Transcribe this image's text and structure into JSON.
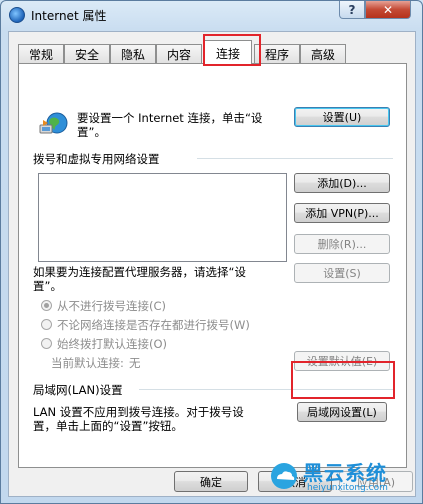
{
  "window": {
    "title": "Internet 属性",
    "help_label": "?",
    "close_label": "✕",
    "icon": "globe-icon"
  },
  "tabs": [
    {
      "label": "常规"
    },
    {
      "label": "安全"
    },
    {
      "label": "隐私"
    },
    {
      "label": "内容"
    },
    {
      "label": "连接",
      "active": true
    },
    {
      "label": "程序"
    },
    {
      "label": "高级"
    }
  ],
  "setup": {
    "text_line1": "要设置一个 Internet 连接，单击“设",
    "text_line2": "置”。",
    "button": "设置(U)",
    "icon": "network-globe-icon"
  },
  "dialup": {
    "heading": "拨号和虚拟专用网络设置",
    "add_button": "添加(D)...",
    "add_vpn_button": "添加 VPN(P)...",
    "delete_button": "删除(R)...",
    "proxy_text_line1": "如果要为连接配置代理服务器，请选择“设",
    "proxy_text_line2": "置”。",
    "settings_button": "设置(S)",
    "options": [
      {
        "label": "从不进行拨号连接(C)",
        "checked": true
      },
      {
        "label": "不论网络连接是否存在都进行拨号(W)",
        "checked": false
      },
      {
        "label": "始终拨打默认连接(O)",
        "checked": false
      }
    ],
    "current_default_label": "当前默认连接:",
    "current_default_value": "无",
    "set_default_button": "设置默认值(E)"
  },
  "lan": {
    "heading": "局域网(LAN)设置",
    "text_line1": "LAN 设置不应用到拨号连接。对于拨号设",
    "text_line2": "置，单击上面的“设置”按钮。",
    "button": "局域网设置(L)"
  },
  "footer": {
    "ok": "确定",
    "cancel": "取消",
    "apply": "应用(A)"
  },
  "watermark": {
    "brand": "黑云系统",
    "url": "heiyunxitong.com"
  },
  "colors": {
    "highlight_box": "#e2242b"
  }
}
